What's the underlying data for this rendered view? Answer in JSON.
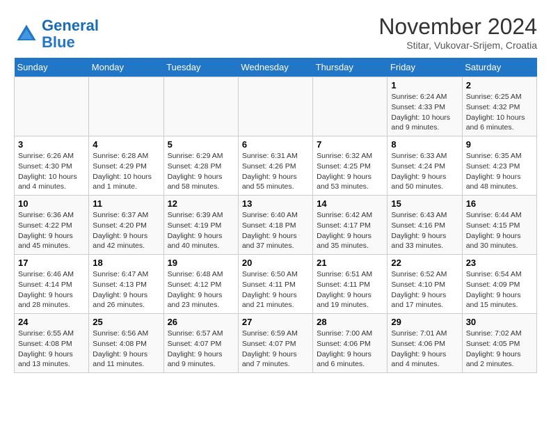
{
  "header": {
    "logo_line1": "General",
    "logo_line2": "Blue",
    "month": "November 2024",
    "location": "Stitar, Vukovar-Srijem, Croatia"
  },
  "days_of_week": [
    "Sunday",
    "Monday",
    "Tuesday",
    "Wednesday",
    "Thursday",
    "Friday",
    "Saturday"
  ],
  "weeks": [
    [
      {
        "day": "",
        "info": ""
      },
      {
        "day": "",
        "info": ""
      },
      {
        "day": "",
        "info": ""
      },
      {
        "day": "",
        "info": ""
      },
      {
        "day": "",
        "info": ""
      },
      {
        "day": "1",
        "info": "Sunrise: 6:24 AM\nSunset: 4:33 PM\nDaylight: 10 hours and 9 minutes."
      },
      {
        "day": "2",
        "info": "Sunrise: 6:25 AM\nSunset: 4:32 PM\nDaylight: 10 hours and 6 minutes."
      }
    ],
    [
      {
        "day": "3",
        "info": "Sunrise: 6:26 AM\nSunset: 4:30 PM\nDaylight: 10 hours and 4 minutes."
      },
      {
        "day": "4",
        "info": "Sunrise: 6:28 AM\nSunset: 4:29 PM\nDaylight: 10 hours and 1 minute."
      },
      {
        "day": "5",
        "info": "Sunrise: 6:29 AM\nSunset: 4:28 PM\nDaylight: 9 hours and 58 minutes."
      },
      {
        "day": "6",
        "info": "Sunrise: 6:31 AM\nSunset: 4:26 PM\nDaylight: 9 hours and 55 minutes."
      },
      {
        "day": "7",
        "info": "Sunrise: 6:32 AM\nSunset: 4:25 PM\nDaylight: 9 hours and 53 minutes."
      },
      {
        "day": "8",
        "info": "Sunrise: 6:33 AM\nSunset: 4:24 PM\nDaylight: 9 hours and 50 minutes."
      },
      {
        "day": "9",
        "info": "Sunrise: 6:35 AM\nSunset: 4:23 PM\nDaylight: 9 hours and 48 minutes."
      }
    ],
    [
      {
        "day": "10",
        "info": "Sunrise: 6:36 AM\nSunset: 4:22 PM\nDaylight: 9 hours and 45 minutes."
      },
      {
        "day": "11",
        "info": "Sunrise: 6:37 AM\nSunset: 4:20 PM\nDaylight: 9 hours and 42 minutes."
      },
      {
        "day": "12",
        "info": "Sunrise: 6:39 AM\nSunset: 4:19 PM\nDaylight: 9 hours and 40 minutes."
      },
      {
        "day": "13",
        "info": "Sunrise: 6:40 AM\nSunset: 4:18 PM\nDaylight: 9 hours and 37 minutes."
      },
      {
        "day": "14",
        "info": "Sunrise: 6:42 AM\nSunset: 4:17 PM\nDaylight: 9 hours and 35 minutes."
      },
      {
        "day": "15",
        "info": "Sunrise: 6:43 AM\nSunset: 4:16 PM\nDaylight: 9 hours and 33 minutes."
      },
      {
        "day": "16",
        "info": "Sunrise: 6:44 AM\nSunset: 4:15 PM\nDaylight: 9 hours and 30 minutes."
      }
    ],
    [
      {
        "day": "17",
        "info": "Sunrise: 6:46 AM\nSunset: 4:14 PM\nDaylight: 9 hours and 28 minutes."
      },
      {
        "day": "18",
        "info": "Sunrise: 6:47 AM\nSunset: 4:13 PM\nDaylight: 9 hours and 26 minutes."
      },
      {
        "day": "19",
        "info": "Sunrise: 6:48 AM\nSunset: 4:12 PM\nDaylight: 9 hours and 23 minutes."
      },
      {
        "day": "20",
        "info": "Sunrise: 6:50 AM\nSunset: 4:11 PM\nDaylight: 9 hours and 21 minutes."
      },
      {
        "day": "21",
        "info": "Sunrise: 6:51 AM\nSunset: 4:11 PM\nDaylight: 9 hours and 19 minutes."
      },
      {
        "day": "22",
        "info": "Sunrise: 6:52 AM\nSunset: 4:10 PM\nDaylight: 9 hours and 17 minutes."
      },
      {
        "day": "23",
        "info": "Sunrise: 6:54 AM\nSunset: 4:09 PM\nDaylight: 9 hours and 15 minutes."
      }
    ],
    [
      {
        "day": "24",
        "info": "Sunrise: 6:55 AM\nSunset: 4:08 PM\nDaylight: 9 hours and 13 minutes."
      },
      {
        "day": "25",
        "info": "Sunrise: 6:56 AM\nSunset: 4:08 PM\nDaylight: 9 hours and 11 minutes."
      },
      {
        "day": "26",
        "info": "Sunrise: 6:57 AM\nSunset: 4:07 PM\nDaylight: 9 hours and 9 minutes."
      },
      {
        "day": "27",
        "info": "Sunrise: 6:59 AM\nSunset: 4:07 PM\nDaylight: 9 hours and 7 minutes."
      },
      {
        "day": "28",
        "info": "Sunrise: 7:00 AM\nSunset: 4:06 PM\nDaylight: 9 hours and 6 minutes."
      },
      {
        "day": "29",
        "info": "Sunrise: 7:01 AM\nSunset: 4:06 PM\nDaylight: 9 hours and 4 minutes."
      },
      {
        "day": "30",
        "info": "Sunrise: 7:02 AM\nSunset: 4:05 PM\nDaylight: 9 hours and 2 minutes."
      }
    ]
  ]
}
